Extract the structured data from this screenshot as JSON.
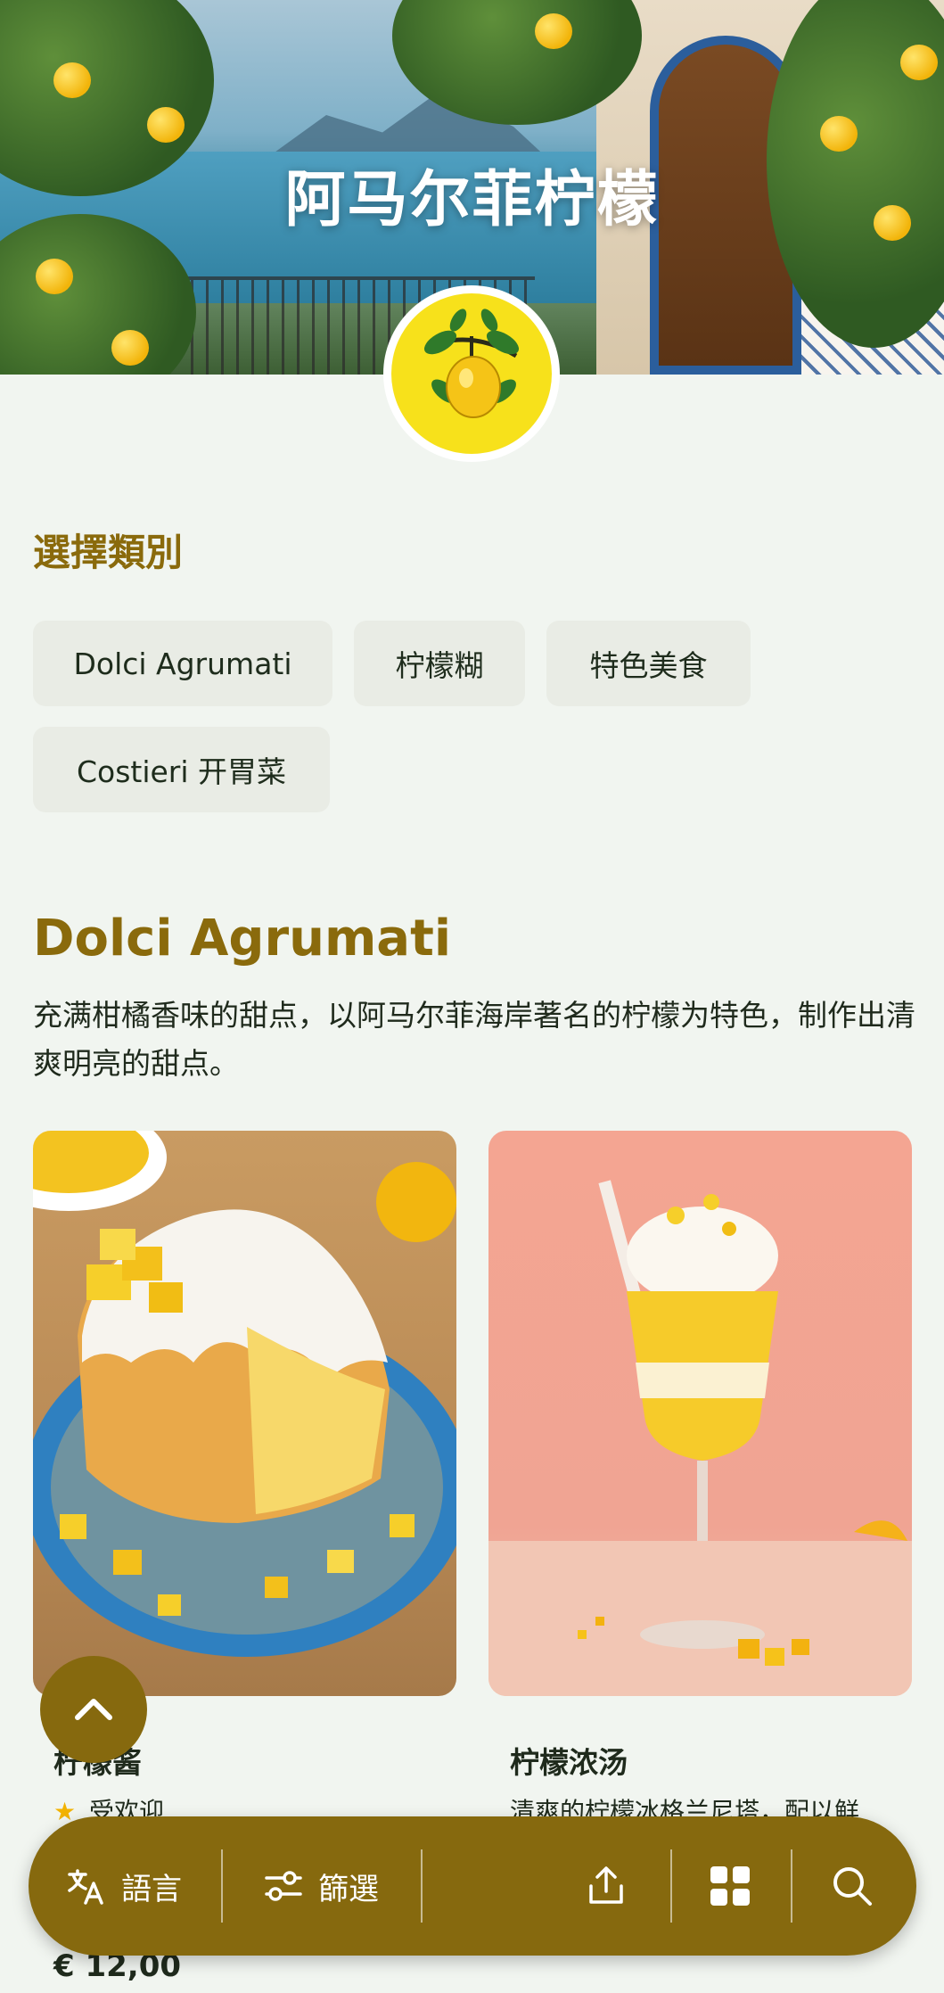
{
  "hero": {
    "title": "阿马尔菲柠檬"
  },
  "categories": {
    "heading": "選擇類別",
    "chips": [
      "Dolci Agrumati",
      "柠檬糊",
      "特色美食",
      "Costieri 开胃菜"
    ]
  },
  "section": {
    "title": "Dolci Agrumati",
    "description": "充满柑橘香味的甜点，以阿马尔菲海岸著名的柠檬为特色，制作出清爽明亮的甜点。"
  },
  "products": [
    {
      "title": "柠檬酱",
      "badge": "受欢迎",
      "price": "€ 12,00"
    },
    {
      "title": "柠檬浓汤",
      "description": "清爽的柠檬冰格兰尼塔，配以鲜"
    }
  ],
  "bottom_bar": {
    "language_label": "語言",
    "filter_label": "篩選"
  },
  "colors": {
    "accent": "#86690e",
    "heading_gold": "#8a6a0c",
    "background": "#f1f5f0",
    "chip_bg": "#e9ece5"
  },
  "icons": {
    "language": "translate-icon",
    "filter": "filter-sliders-icon",
    "share": "share-upload-icon",
    "grid": "grid-view-icon",
    "search": "search-icon",
    "scroll_top": "chevron-up-icon"
  }
}
